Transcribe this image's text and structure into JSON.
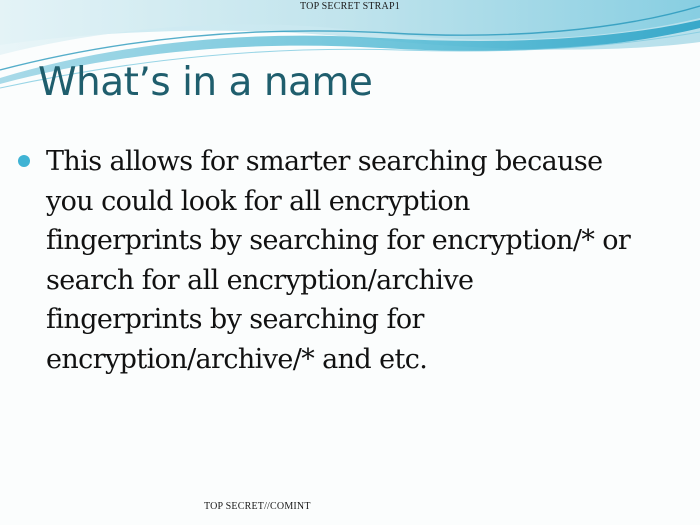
{
  "slide": {
    "top_classification": "TOP SECRET STRAP1",
    "title": "What’s in a name",
    "bullet_lines": [
      "This allows for smarter searching because",
      "you could look for all encryption",
      "fingerprints by searching for encryption/* or",
      "search for all encryption/archive",
      "fingerprints by searching for",
      "encryption/archive/* and etc."
    ],
    "bottom_classification": "TOP SECRET//COMINT"
  },
  "colors": {
    "title": "#1f5e6d",
    "bullet": "#3fb3d4",
    "wave_light": "#bfe3ec",
    "wave_mid": "#5bbdd6",
    "wave_dark": "#1e93b8"
  }
}
